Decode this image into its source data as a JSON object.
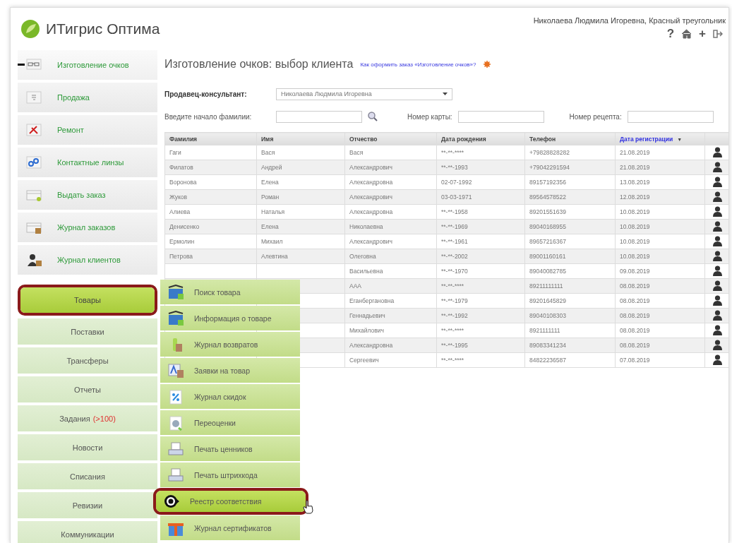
{
  "header": {
    "logo_text": "ИТигрис Оптима",
    "user": "Николаева Людмила Игоревна, Красный треугольник",
    "help_glyph": "?",
    "add_glyph": "+"
  },
  "nav": [
    {
      "kind": "icon",
      "label": "Изготовление очков",
      "current": true,
      "selected": false
    },
    {
      "kind": "icon",
      "label": "Продажа",
      "current": false,
      "selected": false
    },
    {
      "kind": "icon",
      "label": "Ремонт",
      "current": false,
      "selected": false
    },
    {
      "kind": "icon",
      "label": "Контактные линзы",
      "current": false,
      "selected": false
    },
    {
      "kind": "icon",
      "label": "Выдать заказ",
      "current": false,
      "selected": false
    },
    {
      "kind": "icon",
      "label": "Журнал заказов",
      "current": false,
      "selected": false
    },
    {
      "kind": "icon",
      "label": "Журнал клиентов",
      "current": false,
      "selected": false
    },
    {
      "kind": "plain",
      "label": "Товары",
      "current": false,
      "selected": true
    },
    {
      "kind": "plain",
      "label": "Поставки",
      "current": false,
      "selected": false
    },
    {
      "kind": "plain",
      "label": "Трансферы",
      "current": false,
      "selected": false
    },
    {
      "kind": "plain",
      "label": "Отчеты",
      "current": false,
      "selected": false
    },
    {
      "kind": "plain",
      "label": "Задания",
      "badge": "(>100)",
      "current": false,
      "selected": false
    },
    {
      "kind": "plain",
      "label": "Новости",
      "current": false,
      "selected": false
    },
    {
      "kind": "plain",
      "label": "Списания",
      "current": false,
      "selected": false
    },
    {
      "kind": "plain",
      "label": "Ревизии",
      "current": false,
      "selected": false
    },
    {
      "kind": "plain",
      "label": "Коммуникации",
      "current": false,
      "selected": false
    }
  ],
  "page": {
    "title": "Изготовление очков: выбор клиента",
    "help_link": "Как оформить заказ «Изготовление очков»?",
    "seller_label": "Продавец-консультант:",
    "seller_value": "Николаева Людмила Игоревна",
    "surname_label": "Введите начало фамилии:",
    "card_label": "Номер карты:",
    "recipe_label": "Номер рецепта:"
  },
  "table": {
    "sort_mark": "▼",
    "columns": [
      {
        "label": "Фамилия",
        "sorted": false
      },
      {
        "label": "Имя",
        "sorted": false
      },
      {
        "label": "Отчество",
        "sorted": false
      },
      {
        "label": "Дата рождения",
        "sorted": false
      },
      {
        "label": "Телефон",
        "sorted": false
      },
      {
        "label": "Дата регистрации",
        "sorted": true
      }
    ],
    "rows": [
      {
        "surname": "Гаги",
        "name": "Вася",
        "patronymic": "Вася",
        "birth": "**-**-****",
        "phone": "+79828828282",
        "registered": "21.08.2019"
      },
      {
        "surname": "Филатов",
        "name": "Андрей",
        "patronymic": "Александрович",
        "birth": "**-**-1993",
        "phone": "+79042291594",
        "registered": "21.08.2019"
      },
      {
        "surname": "Воронова",
        "name": "Елена",
        "patronymic": "Александровна",
        "birth": "02-07-1992",
        "phone": "89157192356",
        "registered": "13.08.2019"
      },
      {
        "surname": "Жуков",
        "name": "Роман",
        "patronymic": "Александрович",
        "birth": "03-03-1971",
        "phone": "89564578522",
        "registered": "12.08.2019"
      },
      {
        "surname": "Алиева",
        "name": "Наталья",
        "patronymic": "Александровна",
        "birth": "**-**-1958",
        "phone": "89201551639",
        "registered": "10.08.2019"
      },
      {
        "surname": "Денисенко",
        "name": "Елена",
        "patronymic": "Николаевна",
        "birth": "**-**-1969",
        "phone": "89040168955",
        "registered": "10.08.2019"
      },
      {
        "surname": "Ермолин",
        "name": "Михаил",
        "patronymic": "Александрович",
        "birth": "**-**-1961",
        "phone": "89657216367",
        "registered": "10.08.2019"
      },
      {
        "surname": "Петрова",
        "name": "Алевтина",
        "patronymic": "Олеговна",
        "birth": "**-**-2002",
        "phone": "89001160161",
        "registered": "10.08.2019"
      },
      {
        "patronymic": "Васильевна",
        "birth": "**-**-1970",
        "phone": "89040082785",
        "registered": "09.08.2019"
      },
      {
        "patronymic": "ААА",
        "birth": "**-**-****",
        "phone": "89211111111",
        "registered": "08.08.2019"
      },
      {
        "patronymic": "Еганбергановна",
        "birth": "**-**-1979",
        "phone": "89201645829",
        "registered": "08.08.2019"
      },
      {
        "patronymic": "Геннадьевич",
        "birth": "**-**-1992",
        "phone": "89040108303",
        "registered": "08.08.2019"
      },
      {
        "patronymic": "Михайлович",
        "birth": "**-**-****",
        "phone": "8921111111",
        "registered": "08.08.2019"
      },
      {
        "patronymic": "Александровна",
        "birth": "**-**-1995",
        "phone": "89083341234",
        "registered": "08.08.2019"
      },
      {
        "patronymic": "Сергеевич",
        "birth": "**-**-****",
        "phone": "84822236587",
        "registered": "07.08.2019"
      }
    ]
  },
  "submenu": [
    {
      "label": "Поиск товара",
      "selected": false
    },
    {
      "label": "Информация о товаре",
      "selected": false
    },
    {
      "label": "Журнал возвратов",
      "selected": false
    },
    {
      "label": "Заявки на товар",
      "selected": false
    },
    {
      "label": "Журнал скидок",
      "selected": false
    },
    {
      "label": "Переоценки",
      "selected": false
    },
    {
      "label": "Печать ценников",
      "selected": false
    },
    {
      "label": "Печать штрихкода",
      "selected": false
    },
    {
      "label": "Реестр соответствия",
      "selected": true
    },
    {
      "label": "Журнал сертификатов",
      "selected": false
    }
  ]
}
